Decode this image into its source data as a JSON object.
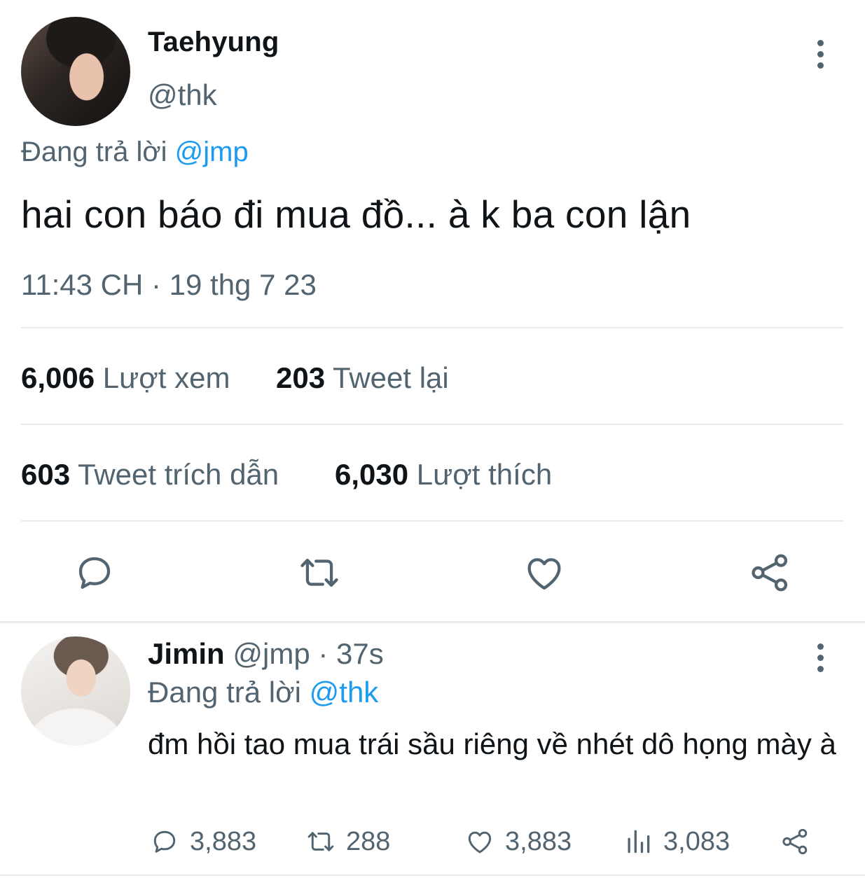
{
  "main_tweet": {
    "author_name": "Taehyung",
    "author_handle": "@thk",
    "replying_prefix": "Đang trả lời",
    "replying_to": "@jmp",
    "text": "hai con báo đi mua đồ... à k ba con lận",
    "timestamp": "11:43 CH · 19 thg 7 23",
    "stats": {
      "views_count": "6,006",
      "views_label": "Lượt xem",
      "retweets_count": "203",
      "retweets_label": "Tweet lại",
      "quotes_count": "603",
      "quotes_label": "Tweet trích dẫn",
      "likes_count": "6,030",
      "likes_label": "Lượt thích"
    },
    "action_icons": [
      "reply-icon",
      "retweet-icon",
      "like-icon",
      "share-icon"
    ]
  },
  "reply_tweet": {
    "author_name": "Jimin",
    "author_handle": "@jmp",
    "time": "· 37s",
    "replying_prefix": "Đang trả lời",
    "replying_to": "@thk",
    "text": "đm hồi tao mua trái sầu riêng về  nhét dô họng mày à",
    "actions": {
      "replies": "3,883",
      "retweets": "288",
      "likes": "3,883",
      "views": "3,083"
    }
  },
  "colors": {
    "text": "#0f1419",
    "secondary": "#536471",
    "link": "#1d9bf0",
    "divider": "#e6ecf0"
  }
}
